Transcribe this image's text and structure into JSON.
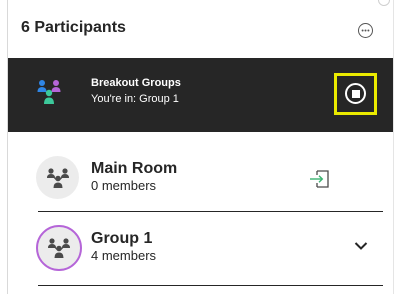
{
  "header": {
    "title": "6 Participants",
    "more_icon": "more-options-icon"
  },
  "breakout": {
    "title": "Breakout Groups",
    "subtitle": "You're in: Group 1",
    "icon": "breakout-groups-icon",
    "stop_icon": "stop-icon",
    "colors": {
      "bar": "#262626",
      "highlight": "#eaea00",
      "person_blue": "#2f86e6",
      "person_purple": "#b565d8",
      "person_green": "#3cc89a"
    }
  },
  "rooms": [
    {
      "name": "Main Room",
      "count": "0 members",
      "action_icon": "join-room-icon",
      "accent": "#3cb371"
    },
    {
      "name": "Group 1",
      "count": "4 members",
      "action_icon": "chevron-down-icon",
      "accent": "#b565d8"
    }
  ]
}
